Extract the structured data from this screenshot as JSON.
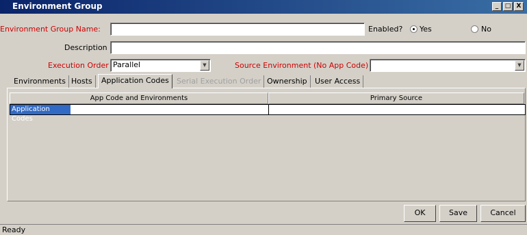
{
  "window": {
    "title": "Environment Group",
    "minimize_glyph": "_",
    "maximize_glyph": "□",
    "close_glyph": "X"
  },
  "form": {
    "group_name_label": "Environment Group Name:",
    "group_name_value": "",
    "enabled_label": "Enabled?",
    "enabled_yes": "Yes",
    "enabled_no": "No",
    "enabled_selected": "Yes",
    "description_label": "Description",
    "description_value": "",
    "execution_order_label": "Execution Order",
    "execution_order_value": "Parallel",
    "source_env_label": "Source Environment (No App Code)",
    "source_env_value": ""
  },
  "tabs": [
    {
      "label": "Environments",
      "state": "normal"
    },
    {
      "label": "Hosts",
      "state": "normal"
    },
    {
      "label": "Application Codes",
      "state": "active"
    },
    {
      "label": "Serial Execution Order",
      "state": "disabled"
    },
    {
      "label": "Ownership",
      "state": "normal"
    },
    {
      "label": "User Access",
      "state": "normal"
    }
  ],
  "table": {
    "columns": [
      "App Code and Environments",
      "Primary Source"
    ],
    "rows": [
      {
        "app_code": "Application Codes",
        "primary_source": ""
      }
    ]
  },
  "buttons": {
    "ok": "OK",
    "save": "Save",
    "cancel": "Cancel"
  },
  "status": "Ready",
  "colors": {
    "title_bar": "#0a246a",
    "required_label": "#cc0000",
    "selection": "#316ac5",
    "background": "#d4d0c8"
  }
}
